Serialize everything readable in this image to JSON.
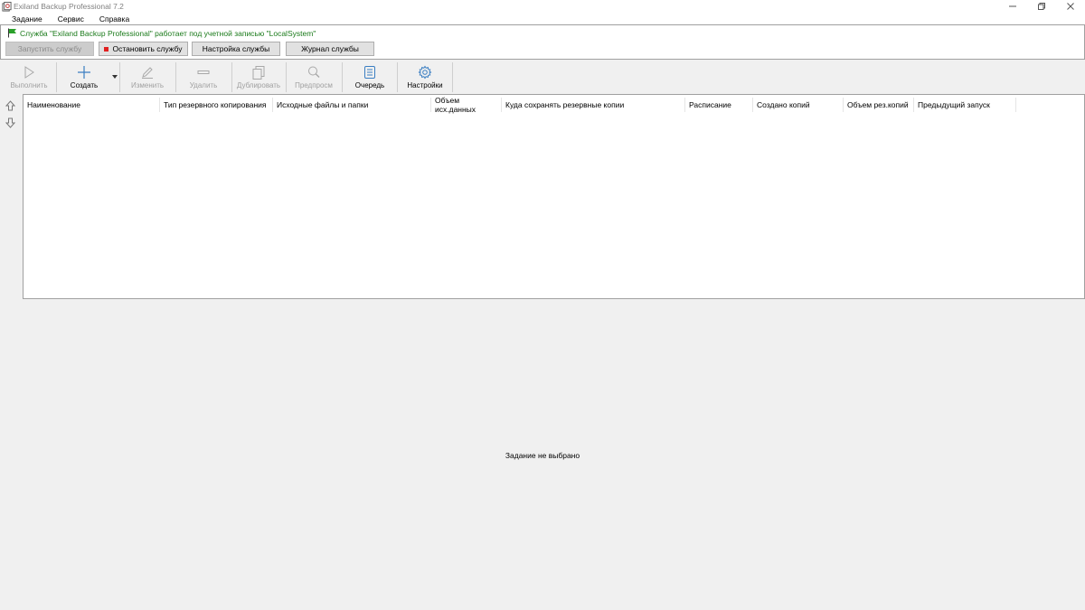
{
  "window": {
    "title": "Exiland Backup Professional 7.2",
    "app_icon": "backup-app-icon",
    "controls": [
      "minimize-icon",
      "restore-icon",
      "close-icon"
    ]
  },
  "menu": {
    "items": [
      {
        "label": "Задание"
      },
      {
        "label": "Сервис"
      },
      {
        "label": "Справка"
      }
    ]
  },
  "service": {
    "status_text": "Служба \"Exiland Backup Professional\" работает под учетной записью \"LocalSystem\"",
    "status_color": "#1a7a1a",
    "buttons": {
      "start": "Запустить службу",
      "stop": "Остановить службу",
      "settings": "Настройка службы",
      "log": "Журнал службы"
    }
  },
  "toolbar": {
    "run": "Выполнить",
    "create": "Создать",
    "edit": "Изменить",
    "delete": "Удалить",
    "duplicate": "Дублировать",
    "preview": "Предпросм",
    "queue": "Очередь",
    "settings": "Настройки"
  },
  "grid": {
    "columns": [
      "Наименование",
      "Тип резервного копирования",
      "Исходные файлы и папки",
      "Объем исх.данных",
      "Куда сохранять резервные копии",
      "Расписание",
      "Создано копий",
      "Объем рез.копий",
      "Предыдущий запуск"
    ],
    "rows": []
  },
  "details": {
    "empty_text": "Задание не выбрано"
  }
}
